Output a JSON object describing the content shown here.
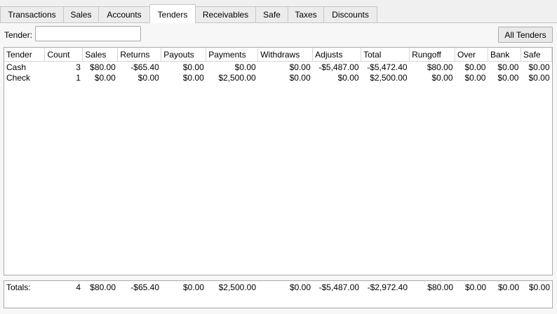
{
  "tabs": [
    "Transactions",
    "Sales",
    "Accounts",
    "Tenders",
    "Receivables",
    "Safe",
    "Taxes",
    "Discounts"
  ],
  "active_tab": "Tenders",
  "filter": {
    "label": "Tender:",
    "value": "",
    "button": "All Tenders"
  },
  "table": {
    "columns": [
      "Tender",
      "Count",
      "Sales",
      "Returns",
      "Payouts",
      "Payments",
      "Withdraws",
      "Adjusts",
      "Total",
      "Rungoff",
      "Over",
      "Bank",
      "Safe"
    ],
    "rows": [
      [
        "Cash",
        "3",
        "$80.00",
        "-$65.40",
        "$0.00",
        "$0.00",
        "$0.00",
        "-$5,487.00",
        "-$5,472.40",
        "$80.00",
        "$0.00",
        "$0.00",
        "$0.00"
      ],
      [
        "Check",
        "1",
        "$0.00",
        "$0.00",
        "$0.00",
        "$2,500.00",
        "$0.00",
        "$0.00",
        "$2,500.00",
        "$0.00",
        "$0.00",
        "$0.00",
        "$0.00"
      ]
    ]
  },
  "totals": [
    "Totals:",
    "4",
    "$80.00",
    "-$65.40",
    "$0.00",
    "$2,500.00",
    "$0.00",
    "-$5,487.00",
    "-$2,972.40",
    "$80.00",
    "$0.00",
    "$0.00",
    "$0.00"
  ]
}
